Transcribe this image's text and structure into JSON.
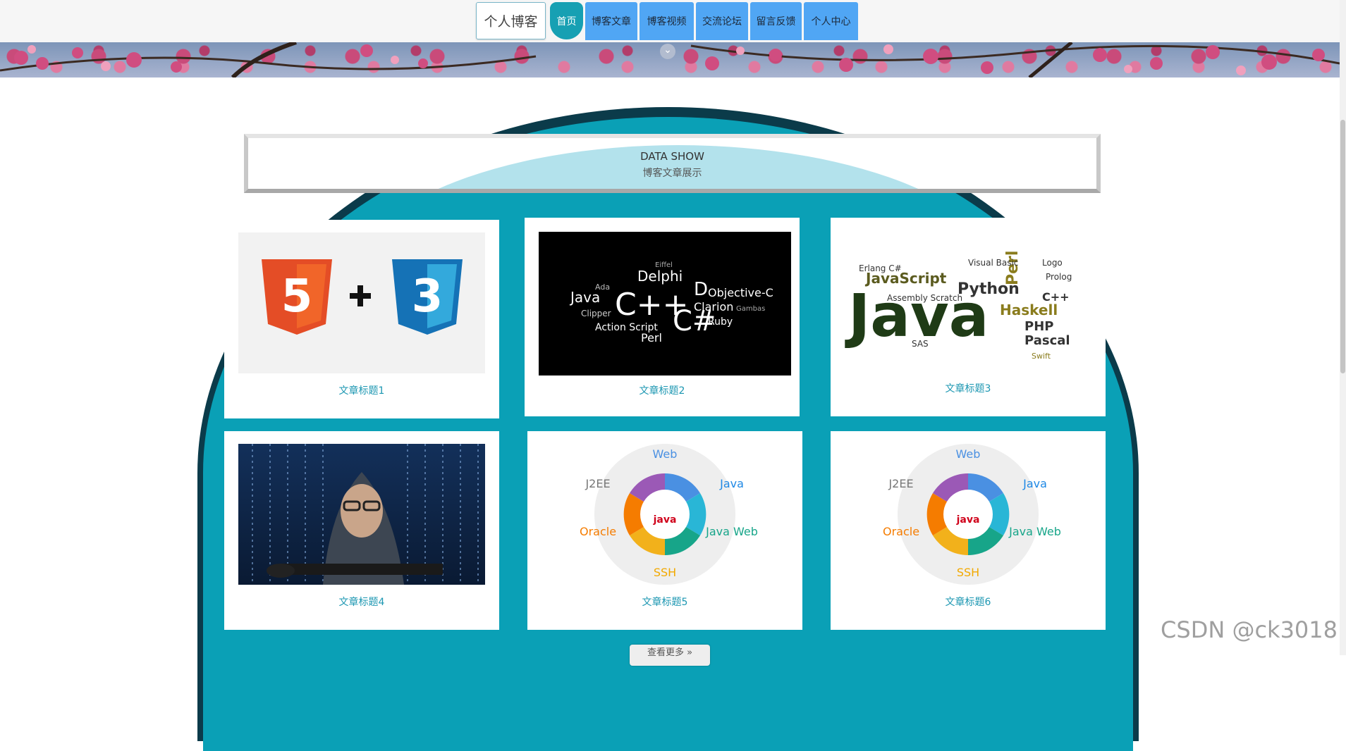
{
  "nav": {
    "brand": "个人博客",
    "items": [
      {
        "label": "首页",
        "active": true
      },
      {
        "label": "博客文章",
        "active": false
      },
      {
        "label": "博客视频",
        "active": false
      },
      {
        "label": "交流论坛",
        "active": false
      },
      {
        "label": "留言反馈",
        "active": false
      },
      {
        "label": "个人中心",
        "active": false
      }
    ]
  },
  "section": {
    "title_en": "DATA SHOW",
    "title_zh": "博客文章展示"
  },
  "cards": [
    {
      "title": "文章标题1",
      "image": "html5-css3-logos"
    },
    {
      "title": "文章标题2",
      "image": "programming-language-word-cloud-dark"
    },
    {
      "title": "文章标题3",
      "image": "java-word-cloud"
    },
    {
      "title": "文章标题4",
      "image": "hooded-hacker-keyboard"
    },
    {
      "title": "文章标题5",
      "image": "java-ecosystem-wheel"
    },
    {
      "title": "文章标题6",
      "image": "java-ecosystem-wheel"
    }
  ],
  "more_button": "查看更多 »",
  "watermark": "CSDN @ck3018",
  "colors": {
    "teal": "#0aa0b6",
    "nav_blue": "#50a6f4",
    "nav_active": "#17a0b3",
    "card_title": "#1c97b2"
  }
}
